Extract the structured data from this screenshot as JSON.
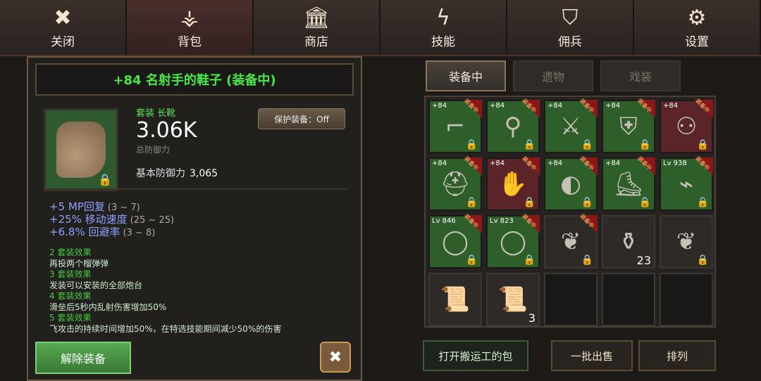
{
  "nav": [
    {
      "label": "关闭",
      "icon": "close-icon",
      "glyph": "✖"
    },
    {
      "label": "背包",
      "icon": "bag-icon",
      "glyph": "⚶"
    },
    {
      "label": "商店",
      "icon": "shop-icon",
      "glyph": "🏛"
    },
    {
      "label": "技能",
      "icon": "skill-icon",
      "glyph": "ϟ"
    },
    {
      "label": "佣兵",
      "icon": "mercenary-icon",
      "glyph": "⛉"
    },
    {
      "label": "设置",
      "icon": "gear-icon",
      "glyph": "⚙"
    }
  ],
  "item": {
    "title": "+84 名射手的鞋子 (装备中)",
    "subtype": "套装 长靴",
    "value": "3.06K",
    "value_label": "总防御力",
    "base_label": "基本防御力",
    "base_value": "3,065",
    "protect": "保护装备：Off",
    "stats": [
      {
        "v": "+5 MP回复",
        "r": "(3 ~ 7)"
      },
      {
        "v": "+25% 移动速度",
        "r": "(25 ~ 25)"
      },
      {
        "v": "+6.8% 回避率",
        "r": "(3 ~ 8)"
      }
    ],
    "set_lines": [
      {
        "t": "h",
        "text": "2 套装效果"
      },
      {
        "t": "d",
        "text": "再投两个榴弹弹"
      },
      {
        "t": "h",
        "text": "3 套装效果"
      },
      {
        "t": "d",
        "text": "发装可以安装的全部炮台"
      },
      {
        "t": "h",
        "text": "4 套装效果"
      },
      {
        "t": "d",
        "text": "滑垒后5秒内乱射伤害增加50%"
      },
      {
        "t": "h",
        "text": "5 套装效果"
      },
      {
        "t": "d",
        "text": "飞攻击的持续时间增加50%，在特选技能期间减少50%的伤害"
      }
    ],
    "unequip": "解除装备"
  },
  "right_tabs": [
    "装备中",
    "遗物",
    "戏装"
  ],
  "inventory": [
    {
      "bg": "g",
      "lvl": "+84",
      "eq": true,
      "lock": true,
      "art": "⌐"
    },
    {
      "bg": "g",
      "lvl": "+84",
      "eq": true,
      "lock": true,
      "art": "⚲"
    },
    {
      "bg": "g",
      "lvl": "+84",
      "eq": true,
      "lock": true,
      "art": "⚔"
    },
    {
      "bg": "g",
      "lvl": "+84",
      "eq": true,
      "lock": true,
      "art": "⛨"
    },
    {
      "bg": "p",
      "lvl": "+84",
      "eq": true,
      "lock": true,
      "art": "⚇"
    },
    {
      "bg": "g",
      "lvl": "+84",
      "eq": true,
      "lock": true,
      "art": "⛑"
    },
    {
      "bg": "p",
      "lvl": "+84",
      "eq": true,
      "lock": true,
      "art": "✋"
    },
    {
      "bg": "g",
      "lvl": "+84",
      "eq": true,
      "lock": true,
      "art": "◐"
    },
    {
      "bg": "g",
      "lvl": "+84",
      "eq": true,
      "lock": true,
      "art": "⛸"
    },
    {
      "bg": "g",
      "lvl": "Lv 938",
      "eq": true,
      "lock": true,
      "art": "⌁"
    },
    {
      "bg": "g",
      "lvl": "Lv 846",
      "eq": true,
      "lock": true,
      "art": "◯"
    },
    {
      "bg": "g",
      "lvl": "Lv 823",
      "eq": true,
      "lock": true,
      "art": "◯"
    },
    {
      "bg": "o",
      "lvl": "",
      "eq": true,
      "lock": true,
      "art": "❦"
    },
    {
      "bg": "o",
      "lvl": "",
      "eq": false,
      "lock": false,
      "art": "⚱",
      "count": "23"
    },
    {
      "bg": "o",
      "lvl": "",
      "eq": false,
      "lock": true,
      "art": "❦"
    },
    {
      "bg": "o",
      "lvl": "",
      "eq": false,
      "lock": false,
      "art": "📜"
    },
    {
      "bg": "o",
      "lvl": "",
      "eq": false,
      "lock": false,
      "art": "📜",
      "count": "3"
    },
    {
      "bg": "e"
    },
    {
      "bg": "e"
    },
    {
      "bg": "e"
    }
  ],
  "buttons": {
    "open": "打开搬运工的包",
    "sell": "一批出售",
    "sort": "排列"
  },
  "equipped_tag": "装备中"
}
